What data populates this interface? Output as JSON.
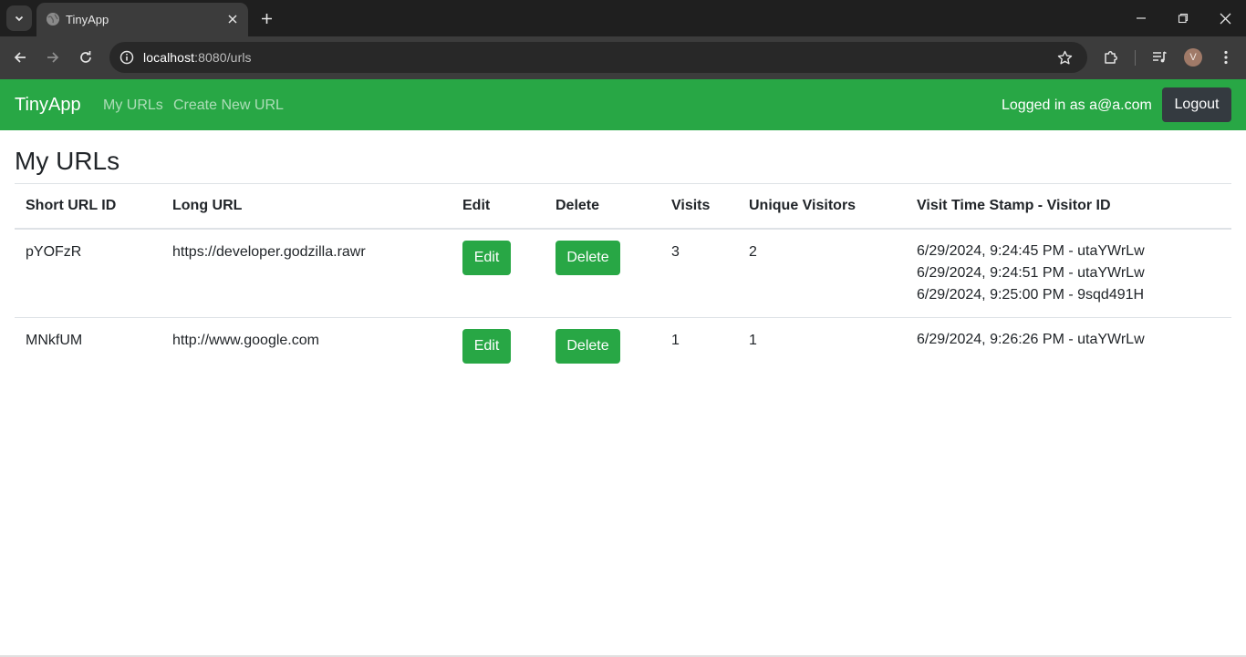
{
  "browser": {
    "tab_title": "TinyApp",
    "url_host": "localhost",
    "url_path": ":8080/urls",
    "profile_initial": "V"
  },
  "navbar": {
    "brand": "TinyApp",
    "links": [
      "My URLs",
      "Create New URL"
    ],
    "logged_in_text": "Logged in as a@a.com",
    "logout_label": "Logout",
    "color": "#28a745"
  },
  "page": {
    "title": "My URLs"
  },
  "table": {
    "headers": [
      "Short URL ID",
      "Long URL",
      "Edit",
      "Delete",
      "Visits",
      "Unique Visitors",
      "Visit Time Stamp - Visitor ID"
    ],
    "rows": [
      {
        "short_id": "pYOFzR",
        "long_url": "https://developer.godzilla.rawr",
        "edit_label": "Edit",
        "delete_label": "Delete",
        "visits": "3",
        "unique_visitors": "2",
        "timestamps": [
          "6/29/2024, 9:24:45 PM - utaYWrLw",
          "6/29/2024, 9:24:51 PM - utaYWrLw",
          "6/29/2024, 9:25:00 PM - 9sqd491H"
        ]
      },
      {
        "short_id": "MNkfUM",
        "long_url": "http://www.google.com",
        "edit_label": "Edit",
        "delete_label": "Delete",
        "visits": "1",
        "unique_visitors": "1",
        "timestamps": [
          "6/29/2024, 9:26:26 PM - utaYWrLw"
        ]
      }
    ]
  },
  "icons": {
    "tab_list": "chevron-down-icon",
    "favicon": "globe-icon",
    "tab_close": "close-icon",
    "new_tab": "plus-icon",
    "back": "arrow-left-icon",
    "forward": "arrow-right-icon",
    "reload": "reload-icon",
    "site_info": "info-icon",
    "bookmark": "star-icon",
    "extensions": "puzzle-icon",
    "media": "media-control-icon",
    "menu": "kebab-menu-icon"
  }
}
